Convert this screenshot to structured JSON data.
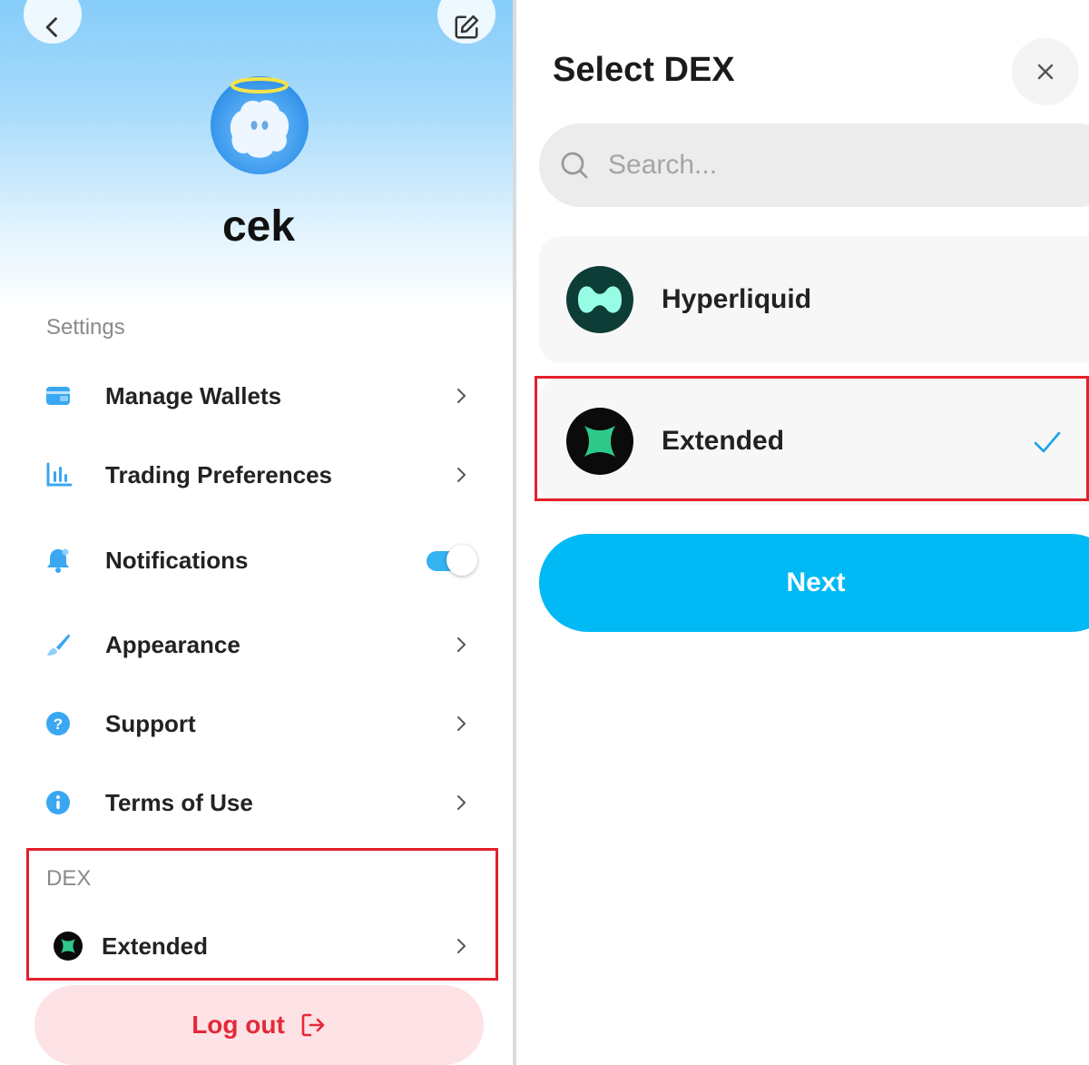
{
  "profile": {
    "username": "cek",
    "back_icon": "chevron-left-icon",
    "edit_icon": "edit-icon",
    "avatar_icon": "angel-ghost-avatar"
  },
  "settings": {
    "section_label": "Settings",
    "items": [
      {
        "label": "Manage Wallets",
        "icon": "wallet-icon",
        "control": "chevron"
      },
      {
        "label": "Trading Preferences",
        "icon": "bar-chart-icon",
        "control": "chevron"
      },
      {
        "label": "Notifications",
        "icon": "bell-icon",
        "control": "toggle",
        "toggle_on": true
      },
      {
        "label": "Appearance",
        "icon": "brush-icon",
        "control": "chevron"
      },
      {
        "label": "Support",
        "icon": "help-icon",
        "control": "chevron"
      },
      {
        "label": "Terms of Use",
        "icon": "info-icon",
        "control": "chevron"
      }
    ]
  },
  "dex_section": {
    "label": "DEX",
    "current": {
      "label": "Extended",
      "icon": "extended-logo-icon"
    }
  },
  "logout": {
    "label": "Log out",
    "icon": "logout-icon"
  },
  "select_dex": {
    "title": "Select DEX",
    "close_icon": "close-icon",
    "search_placeholder": "Search...",
    "options": [
      {
        "name": "Hyperliquid",
        "icon": "hyperliquid-logo-icon",
        "selected": false
      },
      {
        "name": "Extended",
        "icon": "extended-logo-icon",
        "selected": true
      }
    ],
    "next_label": "Next"
  },
  "colors": {
    "accent_blue": "#00b9f5",
    "toggle_blue": "#33b3f0",
    "highlight_red": "#e3202b",
    "logout_red": "#e5283a",
    "hyperliquid_teal": "#97fce4",
    "extended_green": "#2ec98a"
  }
}
